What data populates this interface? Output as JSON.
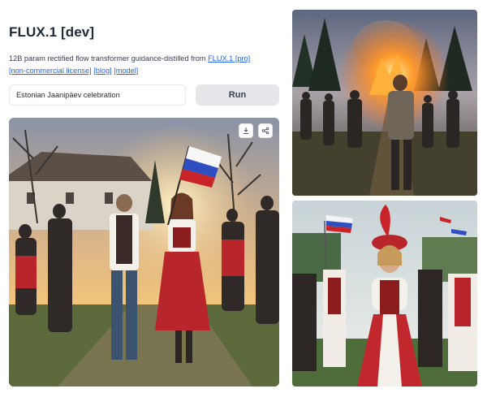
{
  "app": {
    "title": "FLUX.1 [dev]",
    "description_prefix": "12B param rectified flow transformer guidance-distilled from",
    "link_pro": "FLUX.1 [pro]",
    "link_license": "[non-commercial license]",
    "link_blog": "[blog]",
    "link_model": "[model]"
  },
  "input": {
    "prompt_value": "Estonian Jaanipäev celebration"
  },
  "actions": {
    "run_label": "Run",
    "download_icon": "download-icon",
    "share_icon": "share-icon"
  },
  "images": {
    "main": "festival crowd with a woman waving a white-blue-red flag at sunset",
    "top_right": "man walking toward a large bonfire at dusk with crowd",
    "bottom_right": "smiling woman in red folk costume with red feathered headdress, flags behind"
  },
  "colors": {
    "link": "#2563eb",
    "button_bg": "#e5e7eb"
  }
}
